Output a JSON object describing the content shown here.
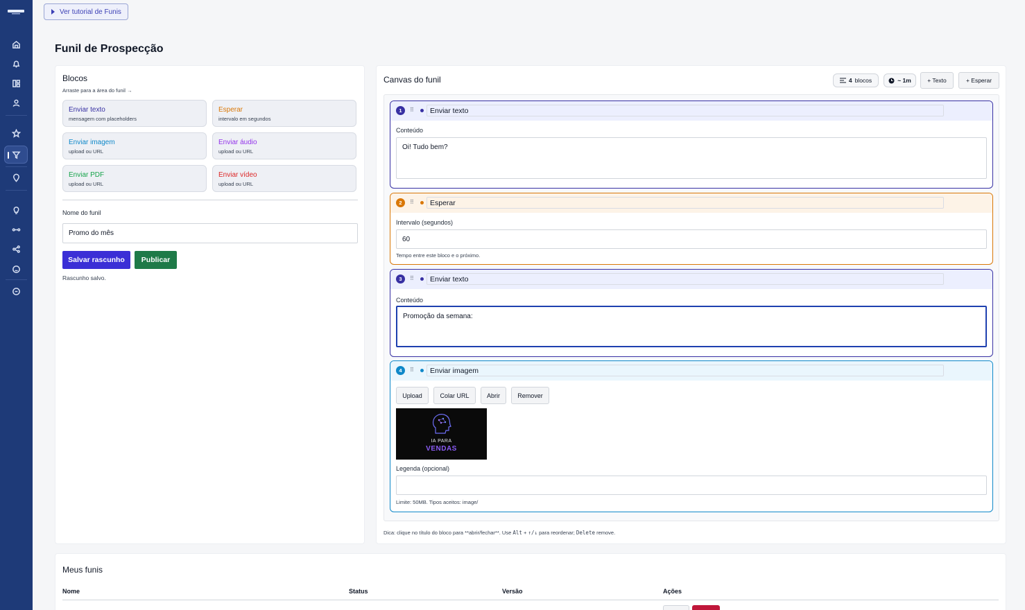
{
  "tutorial_button": "Ver tutorial de Funis",
  "page_title": "Funil de Prospecção",
  "palette": {
    "title": "Blocos",
    "subtitle": "Arraste para a área do funil →",
    "items": [
      {
        "title": "Enviar texto",
        "sub": "mensagem com placeholders",
        "color": "#3730a3"
      },
      {
        "title": "Esperar",
        "sub": "intervalo em segundos",
        "color": "#d97706"
      },
      {
        "title": "Enviar imagem",
        "sub": "upload ou URL",
        "color": "#0e88c9"
      },
      {
        "title": "Enviar áudio",
        "sub": "upload ou URL",
        "color": "#9333ea"
      },
      {
        "title": "Enviar PDF",
        "sub": "upload ou URL",
        "color": "#16a34a"
      },
      {
        "title": "Enviar vídeo",
        "sub": "upload ou URL",
        "color": "#dc2626"
      }
    ]
  },
  "form": {
    "name_label": "Nome do funil",
    "name_value": "Promo do mês",
    "save_label": "Salvar rascunho",
    "publish_label": "Publicar",
    "status": "Rascunho salvo."
  },
  "canvas": {
    "title": "Canvas do funil",
    "count": "4",
    "count_unit": "blocos",
    "duration": "~ 1m",
    "add_text": "+ Texto",
    "add_wait": "+ Esperar",
    "tip": {
      "t1": "Dica: clique no título do bloco para **abrir/fechar**. Use ",
      "k1": "Alt",
      "t2": " + ",
      "k2": "↑/↓",
      "t3": " para reordenar; ",
      "k3": "Delete",
      "t4": " remove."
    }
  },
  "blocks": [
    {
      "num": "1",
      "title": "Enviar texto",
      "label": "Conteúdo",
      "value": "Oi! Tudo bem?",
      "color": "#3730a3"
    },
    {
      "num": "2",
      "title": "Esperar",
      "label": "Intervalo (segundos)",
      "value": "60",
      "hint": "Tempo entre este bloco e o próximo.",
      "color": "#d97706"
    },
    {
      "num": "3",
      "title": "Enviar texto",
      "label": "Conteúdo",
      "value": "Promoção da semana:",
      "color": "#3730a3"
    },
    {
      "num": "4",
      "title": "Enviar imagem",
      "buttons": [
        "Upload",
        "Colar URL",
        "Abrir",
        "Remover"
      ],
      "image_text_1": "IA PARA",
      "image_text_2": "VENDAS",
      "caption_label": "Legenda (opcional)",
      "caption_value": "",
      "hint": "Limite: 50MB. Tipos aceitos: image/",
      "color": "#0e88c9"
    }
  ],
  "funnels": {
    "title": "Meus funis",
    "columns": [
      "Nome",
      "Status",
      "Versão",
      "Ações"
    ]
  },
  "sidebar_icons": [
    "logo",
    "home-icon",
    "bell-icon",
    "dashboard-icon",
    "user-icon",
    "star-icon",
    "filter-icon",
    "pin-icon",
    "bulb-icon",
    "link-icon",
    "share-icon",
    "smile-icon",
    "chat-icon"
  ]
}
